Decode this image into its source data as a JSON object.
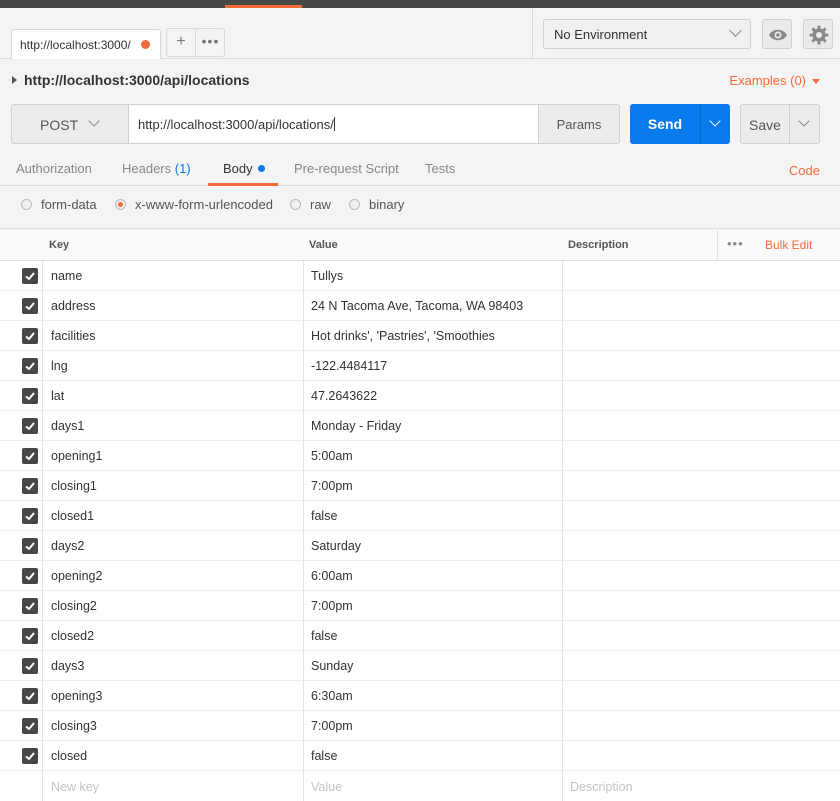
{
  "tabs": {
    "active_tab_label": "http://localhost:3000/",
    "add_label": "+",
    "more_label": "•••"
  },
  "environment": {
    "selected": "No Environment"
  },
  "request": {
    "breadcrumb": "http://localhost:3000/api/locations",
    "examples_label": "Examples (0)",
    "method": "POST",
    "url": "http://localhost:3000/api/locations/",
    "params_label": "Params",
    "send_label": "Send",
    "save_label": "Save"
  },
  "subtabs": {
    "authorization": "Authorization",
    "headers": "Headers",
    "headers_count": "(1)",
    "body": "Body",
    "prerequest": "Pre-request Script",
    "tests": "Tests",
    "code": "Code"
  },
  "body_types": {
    "form_data": "form-data",
    "urlencoded": "x-www-form-urlencoded",
    "raw": "raw",
    "binary": "binary",
    "selected": "x-www-form-urlencoded"
  },
  "table": {
    "headers": {
      "key": "Key",
      "value": "Value",
      "description": "Description",
      "bulk_edit": "Bulk Edit",
      "more": "•••"
    },
    "rows": [
      {
        "key": "name",
        "value": "Tullys"
      },
      {
        "key": "address",
        "value": "24 N Tacoma Ave, Tacoma, WA 98403"
      },
      {
        "key": "facilities",
        "value": "Hot drinks', 'Pastries', 'Smoothies"
      },
      {
        "key": "lng",
        "value": "-122.4484117"
      },
      {
        "key": "lat",
        "value": "47.2643622"
      },
      {
        "key": "days1",
        "value": "Monday - Friday"
      },
      {
        "key": "opening1",
        "value": "5:00am"
      },
      {
        "key": "closing1",
        "value": "7:00pm"
      },
      {
        "key": "closed1",
        "value": "false"
      },
      {
        "key": "days2",
        "value": "Saturday"
      },
      {
        "key": "opening2",
        "value": "6:00am"
      },
      {
        "key": "closing2",
        "value": "7:00pm"
      },
      {
        "key": "closed2",
        "value": "false"
      },
      {
        "key": "days3",
        "value": "Sunday"
      },
      {
        "key": "opening3",
        "value": "6:30am"
      },
      {
        "key": "closing3",
        "value": "7:00pm"
      },
      {
        "key": "closed",
        "value": "false"
      }
    ],
    "new_row": {
      "key_placeholder": "New key",
      "value_placeholder": "Value",
      "description_placeholder": "Description"
    }
  },
  "colors": {
    "accent": "#f26b3a",
    "primary": "#097bed"
  }
}
